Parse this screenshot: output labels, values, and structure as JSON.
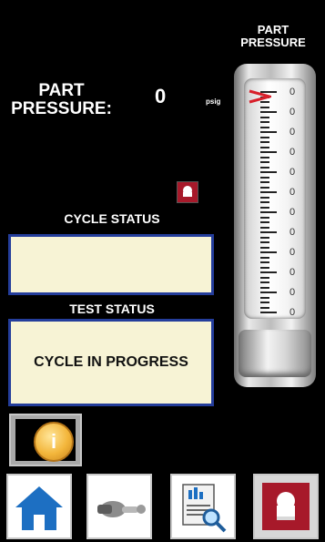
{
  "header": {
    "part_pressure_label_line1": "PART",
    "part_pressure_label_line2": "PRESSURE:",
    "part_pressure_value": "0",
    "part_pressure_unit": "psig"
  },
  "gauge": {
    "title_line1": "PART",
    "title_line2": "PRESSURE",
    "tick_labels": [
      "0",
      "0",
      "0",
      "0",
      "0",
      "0",
      "0",
      "0",
      "0",
      "0",
      "0",
      "0"
    ],
    "level_fraction": 0
  },
  "cycle_status": {
    "label": "CYCLE STATUS",
    "value": ""
  },
  "test_status": {
    "label": "TEST STATUS",
    "value": "CYCLE IN PROGRESS"
  },
  "buttons": {
    "info": "i",
    "info_icon": "info-icon",
    "home_icon": "home-icon",
    "tool_icon": "coupler-icon",
    "report_icon": "report-search-icon",
    "brand_icon": "chef-brand-icon"
  },
  "colors": {
    "status_border": "#243d9b",
    "status_fill": "#f7f3d5",
    "pointer": "#d81f2a",
    "brand": "#a7192a"
  }
}
